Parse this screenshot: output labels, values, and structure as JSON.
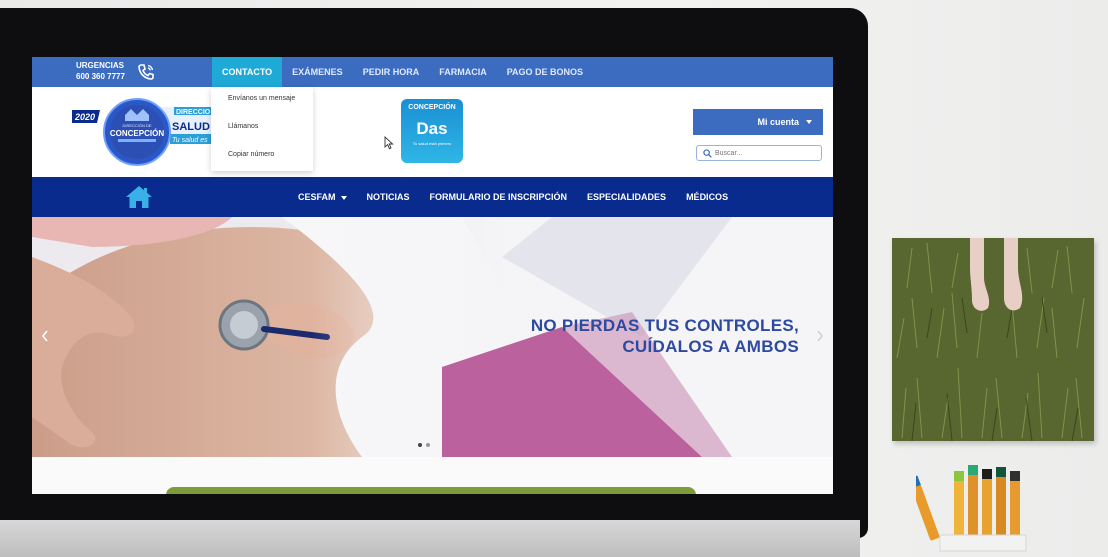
{
  "topbar": {
    "urgencias_label": "URGENCIAS",
    "phone_number": "600 360 7777",
    "nav": [
      "CONTACTO",
      "EXÁMENES",
      "PEDIR HORA",
      "FARMACIA",
      "PAGO DE BONOS"
    ]
  },
  "dropdown": {
    "items": [
      "Envíanos un mensaje",
      "Llámanos",
      "Copiar número"
    ]
  },
  "logo": {
    "year": "2020",
    "name_small": "DIRECCIÓN DE",
    "name_main": "CONCEPCIÓN",
    "salud": "SALUD",
    "tagline": "Tu salud es",
    "direccion": "DIRECCIO"
  },
  "das_app": {
    "top": "CONCEPCIÓN",
    "main": "Das",
    "sub": "Tu salud está primero"
  },
  "account": {
    "mi_cuenta": "Mi cuenta",
    "search_placeholder": "Buscar..."
  },
  "mainnav": {
    "cesfam": "CESFAM",
    "links": [
      "NOTICIAS",
      "FORMULARIO DE INSCRIPCIÓN",
      "ESPECIALIDADES",
      "MÉDICOS"
    ]
  },
  "hero": {
    "line1": "NO PIERDAS TUS CONTROLES,",
    "line2": "CUÍDALOS A AMBOS",
    "slides_total": 2,
    "active_slide": 1
  },
  "colors": {
    "topbar": "#3b6cc0",
    "active_tab": "#1fa9d6",
    "mainnav": "#0a2b8e",
    "hero_text": "#2d4aa0",
    "magenta": "#b0478e"
  },
  "icons": [
    "phone-icon",
    "home-icon",
    "search-icon",
    "chevron-left-icon",
    "chevron-right-icon",
    "cursor-icon"
  ]
}
